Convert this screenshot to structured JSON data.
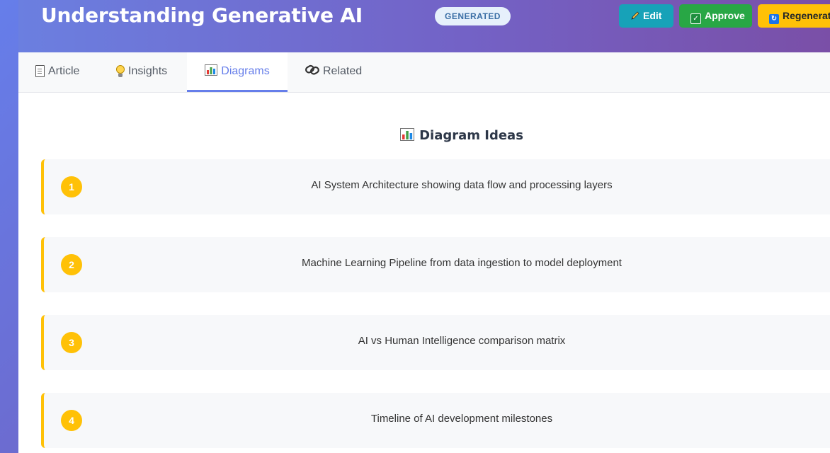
{
  "header": {
    "title": "Understanding Generative AI",
    "status_badge": "GENERATED",
    "buttons": {
      "edit": "Edit",
      "approve": "Approve",
      "regenerate": "Regenerate"
    }
  },
  "tabs": [
    {
      "label": "Article",
      "icon": "document-icon"
    },
    {
      "label": "Insights",
      "icon": "lightbulb-icon"
    },
    {
      "label": "Diagrams",
      "icon": "bar-chart-icon",
      "active": true
    },
    {
      "label": "Related",
      "icon": "link-icon"
    }
  ],
  "diagrams": {
    "title": "Diagram Ideas",
    "items": [
      {
        "number": "1",
        "text": "AI System Architecture showing data flow and processing layers"
      },
      {
        "number": "2",
        "text": "Machine Learning Pipeline from data ingestion to model deployment"
      },
      {
        "number": "3",
        "text": "AI vs Human Intelligence comparison matrix"
      },
      {
        "number": "4",
        "text": "Timeline of AI development milestones"
      }
    ]
  },
  "colors": {
    "header_gradient_start": "#667eea",
    "header_gradient_end": "#764ba2",
    "accent": "#667eea",
    "idea_accent": "#ffc107",
    "edit_button": "#17a2b8",
    "approve_button": "#28a745",
    "regenerate_button": "#ffc107"
  }
}
